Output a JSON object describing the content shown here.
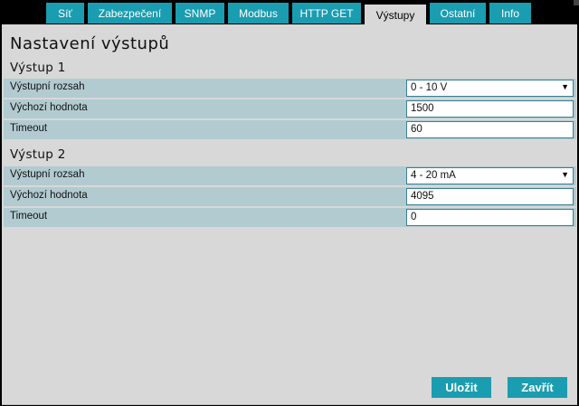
{
  "tabs": [
    {
      "label": "Síť"
    },
    {
      "label": "Zabezpečení"
    },
    {
      "label": "SNMP"
    },
    {
      "label": "Modbus"
    },
    {
      "label": "HTTP GET"
    },
    {
      "label": "Výstupy"
    },
    {
      "label": "Ostatní"
    },
    {
      "label": "Info"
    }
  ],
  "active_tab": "Výstupy",
  "page_title": "Nastavení výstupů",
  "outputs": [
    {
      "title": "Výstup 1",
      "range_label": "Výstupní rozsah",
      "range_value": "0 - 10 V",
      "default_label": "Výchozí hodnota",
      "default_value": "1500",
      "timeout_label": "Timeout",
      "timeout_value": "60"
    },
    {
      "title": "Výstup 2",
      "range_label": "Výstupní rozsah",
      "range_value": "4 - 20 mA",
      "default_label": "Výchozí hodnota",
      "default_value": "4095",
      "timeout_label": "Timeout",
      "timeout_value": "0"
    }
  ],
  "buttons": {
    "save": "Uložit",
    "close": "Zavřít"
  },
  "colors": {
    "accent": "#1a9db0",
    "row_bg": "#b2cbd1",
    "panel_bg": "#d8d8d8"
  }
}
